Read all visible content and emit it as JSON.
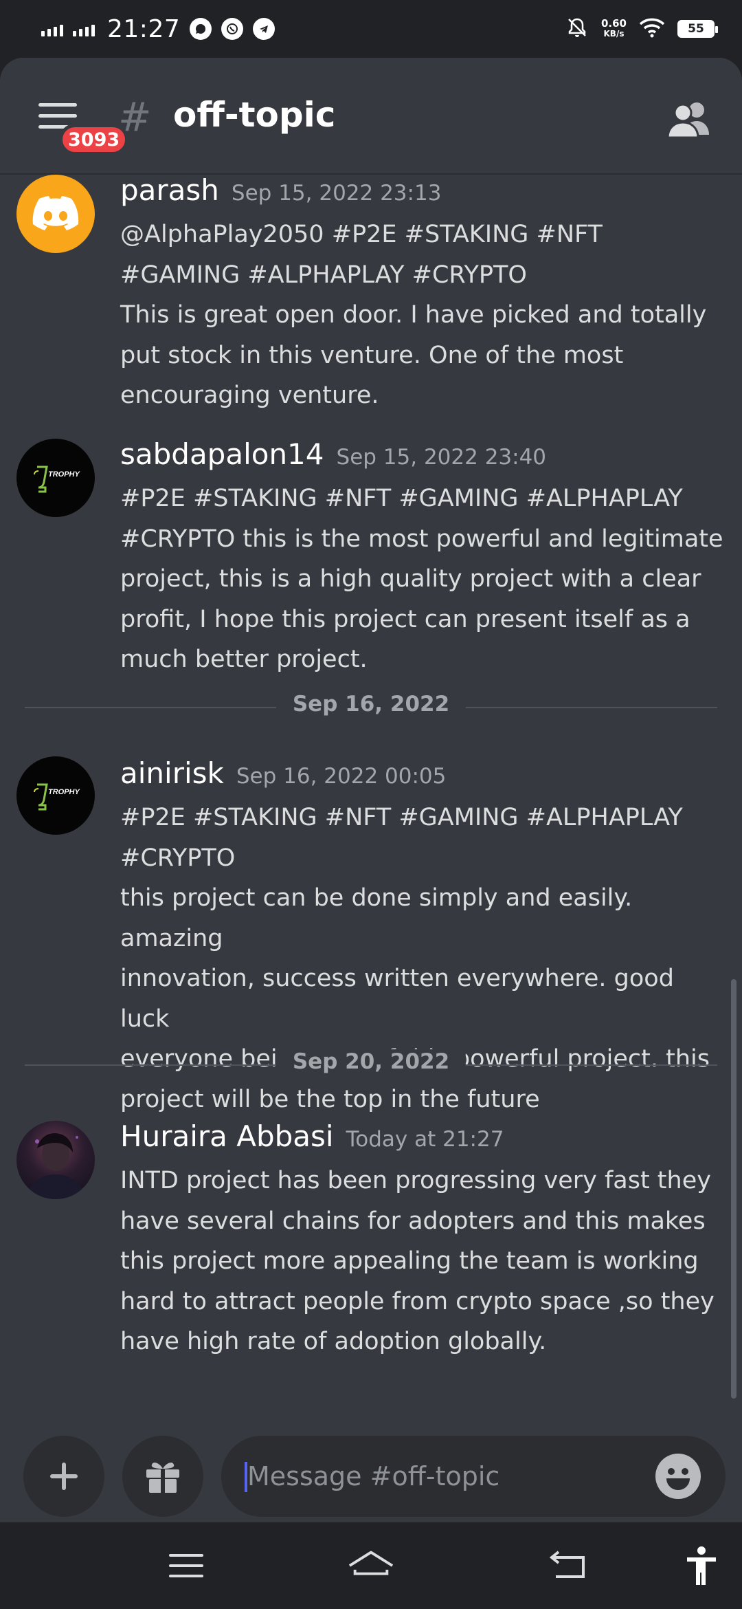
{
  "status_bar": {
    "time": "21:27",
    "net_speed_value": "0.60",
    "net_speed_unit": "KB/s",
    "battery": "55"
  },
  "header": {
    "menu_badge": "3093",
    "channel_hash": "#",
    "channel_name": "off-topic"
  },
  "messages": [
    {
      "username": "parash",
      "timestamp": "Sep 15, 2022 23:13",
      "avatar_icon": "discord-logo-icon",
      "text": "@AlphaPlay2050 #P2E #STAKING #NFT\n#GAMING #ALPHAPLAY #CRYPTO\nThis is great open door. I have picked and totally\nput stock in this venture. One of the most\nencouraging venture."
    },
    {
      "username": "sabdapalon14",
      "timestamp": "Sep 15, 2022 23:40",
      "avatar_icon": "trophy-logo-icon",
      "avatar_text": "TROPHY",
      "text": "#P2E #STAKING #NFT #GAMING #ALPHAPLAY\n#CRYPTO this is the most powerful and legitimate\nproject, this is a high quality project with a clear\nprofit, I hope this project can present itself as a\nmuch better project."
    },
    {
      "username": "ainirisk",
      "timestamp": "Sep 16, 2022 00:05",
      "avatar_icon": "trophy-logo-icon",
      "avatar_text": "TROPHY",
      "text": "#P2E #STAKING #NFT #GAMING #ALPHAPLAY\n#CRYPTO\nthis project can be done simply and easily. amazing\ninnovation, success written everywhere. good luck\neveryone being part of this powerful project. this\nproject will be the top in the future"
    },
    {
      "username": "Huraira Abbasi",
      "timestamp": "Today at 21:27",
      "avatar_icon": "user-photo-avatar",
      "text": "INTD project has been progressing very fast they\nhave several chains for adopters and this makes\nthis project more appealing the team is working\nhard to attract people from crypto space ,so they\nhave high rate of adoption globally."
    }
  ],
  "dividers": [
    "Sep 16, 2022",
    "Sep 20, 2022"
  ],
  "composer": {
    "placeholder": "Message #off-topic",
    "value": ""
  },
  "colors": {
    "background": "#36393f",
    "header_bg": "#36393f",
    "statusbar_bg": "#202225",
    "input_bg": "#2b2d31",
    "badge": "#ed4245",
    "discord_avatar": "#faa61a",
    "caret": "#5865f2"
  },
  "icons": {
    "menu": "hamburger-menu-icon",
    "members": "members-icon",
    "add": "plus-icon",
    "gift": "gift-icon",
    "emoji": "emoji-icon",
    "nav_recent": "recent-apps-icon",
    "nav_home": "home-icon",
    "nav_back": "back-icon",
    "nav_accessibility": "accessibility-icon"
  }
}
